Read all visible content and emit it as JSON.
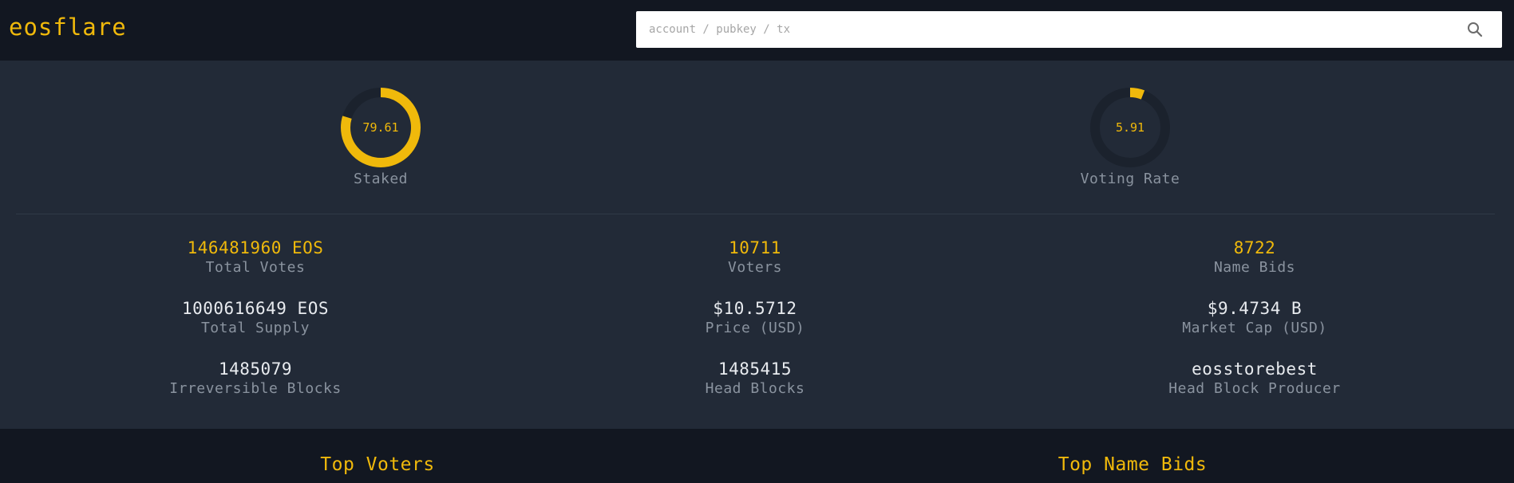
{
  "header": {
    "logo": "eosflare",
    "search_placeholder": "account / pubkey / tx"
  },
  "gauges": [
    {
      "value": "79.61",
      "percent": 79.61,
      "label": "Staked"
    },
    {
      "value": "5.91",
      "percent": 5.91,
      "label": "Voting Rate"
    }
  ],
  "stats": {
    "total_votes": {
      "value": "146481960 EOS",
      "label": "Total Votes"
    },
    "voters": {
      "value": "10711",
      "label": "Voters"
    },
    "name_bids": {
      "value": "8722",
      "label": "Name Bids"
    },
    "total_supply": {
      "value": "1000616649 EOS",
      "label": "Total Supply"
    },
    "price": {
      "value": "$10.5712",
      "label": "Price (USD)"
    },
    "market_cap": {
      "value": "$9.4734 B",
      "label": "Market Cap (USD)"
    },
    "irreversible_blocks": {
      "value": "1485079",
      "label": "Irreversible Blocks"
    },
    "head_blocks": {
      "value": "1485415",
      "label": "Head Blocks"
    },
    "head_block_producer": {
      "value": "eosstorebest",
      "label": "Head Block Producer"
    }
  },
  "sections": {
    "top_voters": "Top Voters",
    "top_name_bids": "Top Name Bids"
  },
  "colors": {
    "accent": "#f0b90b",
    "track": "#1b222d",
    "header_bg": "#121721",
    "panel_bg": "#222a37"
  }
}
